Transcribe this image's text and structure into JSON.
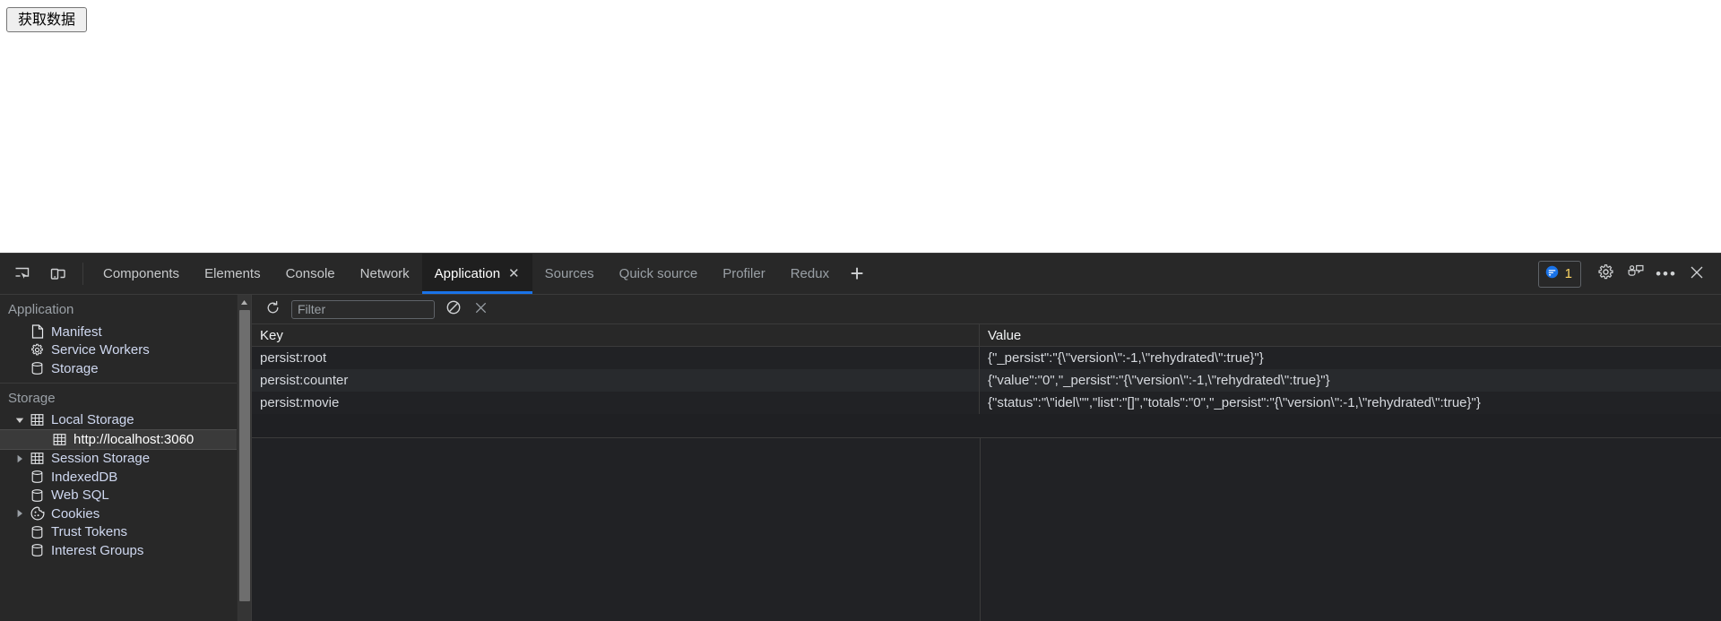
{
  "page": {
    "fetch_button_label": "获取数据"
  },
  "colors": {
    "accent": "#1a73e8",
    "badge_count": "#fdd663",
    "panel_bg": "#1f2023",
    "chrome_bg": "#282828",
    "selected_row": "#3a3a3a"
  },
  "devtools": {
    "left_icons": [
      {
        "name": "inspect-element-icon",
        "label": "Inspect element"
      },
      {
        "name": "device-toolbar-icon",
        "label": "Toggle device toolbar"
      }
    ],
    "tabs": [
      {
        "label": "Components",
        "active": false,
        "dim": false
      },
      {
        "label": "Elements",
        "active": false,
        "dim": false
      },
      {
        "label": "Console",
        "active": false,
        "dim": false
      },
      {
        "label": "Network",
        "active": false,
        "dim": false
      },
      {
        "label": "Application",
        "active": true,
        "dim": false,
        "closable": true
      },
      {
        "label": "Sources",
        "active": false,
        "dim": true
      },
      {
        "label": "Quick source",
        "active": false,
        "dim": true
      },
      {
        "label": "Profiler",
        "active": false,
        "dim": true
      },
      {
        "label": "Redux",
        "active": false,
        "dim": true
      }
    ],
    "tab_close_glyph": "✕",
    "add_tab_glyph": "+",
    "message_badge": {
      "count": "1",
      "icon": "message-icon"
    },
    "right_icons": [
      {
        "name": "settings-gear-icon",
        "label": "Settings"
      },
      {
        "name": "feedback-icon",
        "label": "Send feedback"
      },
      {
        "name": "more-options-icon",
        "label": "Customize and control DevTools",
        "glyph": "•••"
      },
      {
        "name": "close-devtools-icon",
        "label": "Close DevTools",
        "glyph": "✕"
      }
    ]
  },
  "sidebar": {
    "sections": [
      {
        "title": "Application",
        "items": [
          {
            "label": "Manifest",
            "icon": "manifest-document-icon",
            "level": 1,
            "twisty": "",
            "selected": false
          },
          {
            "label": "Service Workers",
            "icon": "service-worker-gear-icon",
            "level": 1,
            "twisty": "",
            "selected": false
          },
          {
            "label": "Storage",
            "icon": "storage-database-icon",
            "level": 1,
            "twisty": "",
            "selected": false
          }
        ]
      },
      {
        "title": "Storage",
        "items": [
          {
            "label": "Local Storage",
            "icon": "table-grid-icon",
            "level": 1,
            "twisty": "expanded",
            "selected": false
          },
          {
            "label": "http://localhost:3060",
            "icon": "table-grid-icon",
            "level": 2,
            "twisty": "",
            "selected": true
          },
          {
            "label": "Session Storage",
            "icon": "table-grid-icon",
            "level": 1,
            "twisty": "collapsed",
            "selected": false
          },
          {
            "label": "IndexedDB",
            "icon": "database-icon",
            "level": 1,
            "twisty": "",
            "selected": false
          },
          {
            "label": "Web SQL",
            "icon": "database-icon",
            "level": 1,
            "twisty": "",
            "selected": false
          },
          {
            "label": "Cookies",
            "icon": "cookie-icon",
            "level": 1,
            "twisty": "collapsed",
            "selected": false
          },
          {
            "label": "Trust Tokens",
            "icon": "database-icon",
            "level": 1,
            "twisty": "",
            "selected": false
          },
          {
            "label": "Interest Groups",
            "icon": "database-icon",
            "level": 1,
            "twisty": "",
            "selected": false
          }
        ]
      }
    ]
  },
  "storage_panel": {
    "toolbar": {
      "refresh_icon": "refresh-icon",
      "filter_placeholder": "Filter",
      "filter_value": "",
      "clear_all_icon": "clear-all-circle-slash-icon",
      "delete_selected_icon": "delete-selected-x-icon"
    },
    "table": {
      "columns": [
        "Key",
        "Value"
      ],
      "rows": [
        {
          "key": "persist:root",
          "value": "{\"_persist\":\"{\\\"version\\\":-1,\\\"rehydrated\\\":true}\"}"
        },
        {
          "key": "persist:counter",
          "value": "{\"value\":\"0\",\"_persist\":\"{\\\"version\\\":-1,\\\"rehydrated\\\":true}\"}"
        },
        {
          "key": "persist:movie",
          "value": "{\"status\":\"\\\"idel\\\"\",\"list\":\"[]\",\"totals\":\"0\",\"_persist\":\"{\\\"version\\\":-1,\\\"rehydrated\\\":true}\"}"
        }
      ]
    }
  }
}
